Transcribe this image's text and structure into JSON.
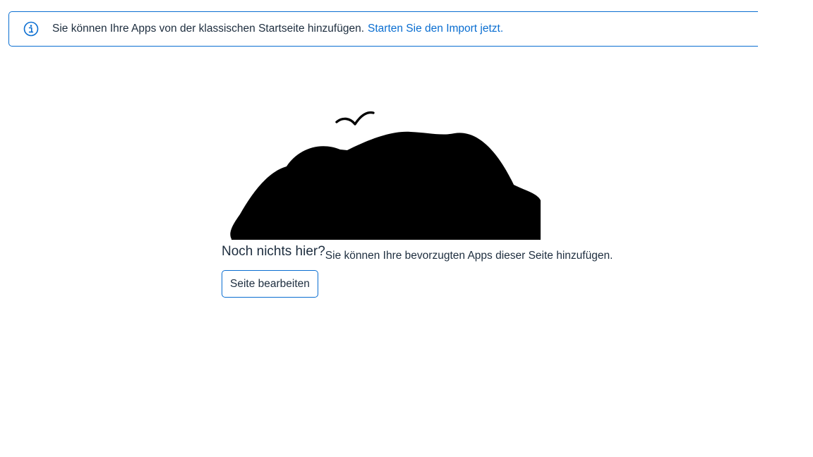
{
  "info_strip": {
    "icon": "information-icon",
    "message": "Sie können Ihre Apps von der klassischen Startseite hinzufügen.",
    "link": "Starten Sie den Import jetzt.",
    "accent_color": "#0a6ed1"
  },
  "empty_state": {
    "illustration": "island-with-bird-illustration",
    "title": "Noch nichts hier?",
    "description": "Sie können Ihre bevorzugten Apps dieser Seite hinzufügen.",
    "button_label": "Seite bearbeiten"
  }
}
